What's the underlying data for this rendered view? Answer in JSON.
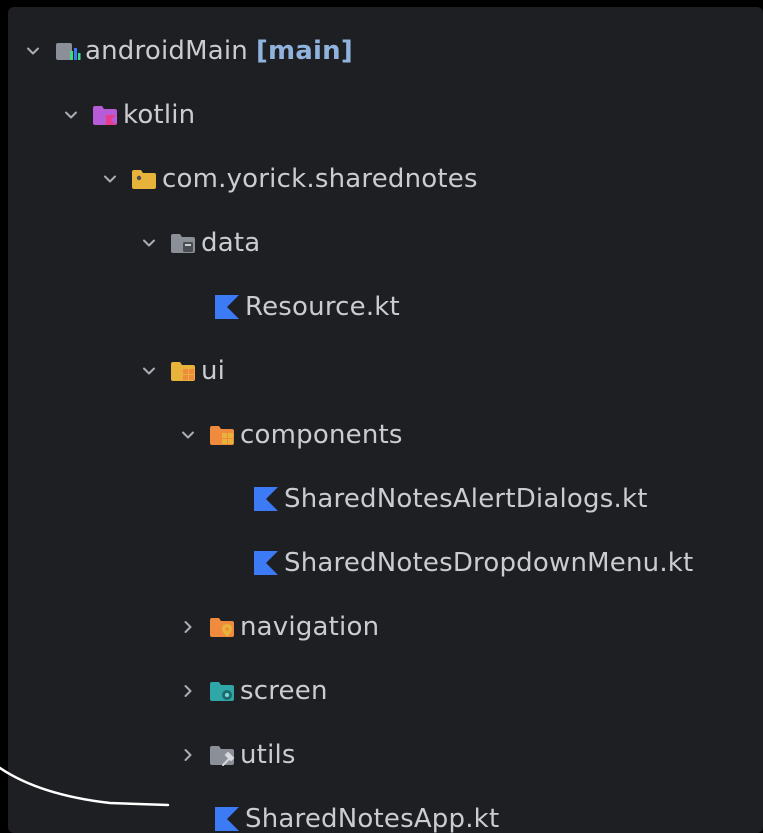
{
  "tree": {
    "root": {
      "label": "androidMain",
      "tag": "[main]",
      "icon": "android-source-root-icon"
    },
    "kotlin": {
      "label": "kotlin",
      "icon": "kotlin-source-folder-icon"
    },
    "package": {
      "label": "com.yorick.sharednotes",
      "icon": "package-folder-icon"
    },
    "data": {
      "label": "data",
      "icon": "data-folder-icon"
    },
    "resource_file": {
      "label": "Resource.kt",
      "icon": "kotlin-file-icon"
    },
    "ui": {
      "label": "ui",
      "icon": "ui-folder-icon"
    },
    "components": {
      "label": "components",
      "icon": "components-folder-icon"
    },
    "alert_dialogs_file": {
      "label": "SharedNotesAlertDialogs.kt",
      "icon": "kotlin-file-icon"
    },
    "dropdown_menu_file": {
      "label": "SharedNotesDropdownMenu.kt",
      "icon": "kotlin-file-icon"
    },
    "navigation": {
      "label": "navigation",
      "icon": "navigation-folder-icon"
    },
    "screen": {
      "label": "screen",
      "icon": "screen-folder-icon"
    },
    "utils": {
      "label": "utils",
      "icon": "utils-folder-icon"
    },
    "app_file": {
      "label": "SharedNotesApp.kt",
      "icon": "kotlin-file-icon"
    }
  },
  "colors": {
    "panel_bg": "#1e1f22",
    "text": "#c9ccd1",
    "kotlin_blue": "#3d7af5",
    "folder_yellow": "#e8b33a",
    "folder_orange": "#f08a3c",
    "folder_teal": "#2fa6a8",
    "folder_gray": "#8a8f98",
    "folder_purple": "#b85bd6"
  }
}
